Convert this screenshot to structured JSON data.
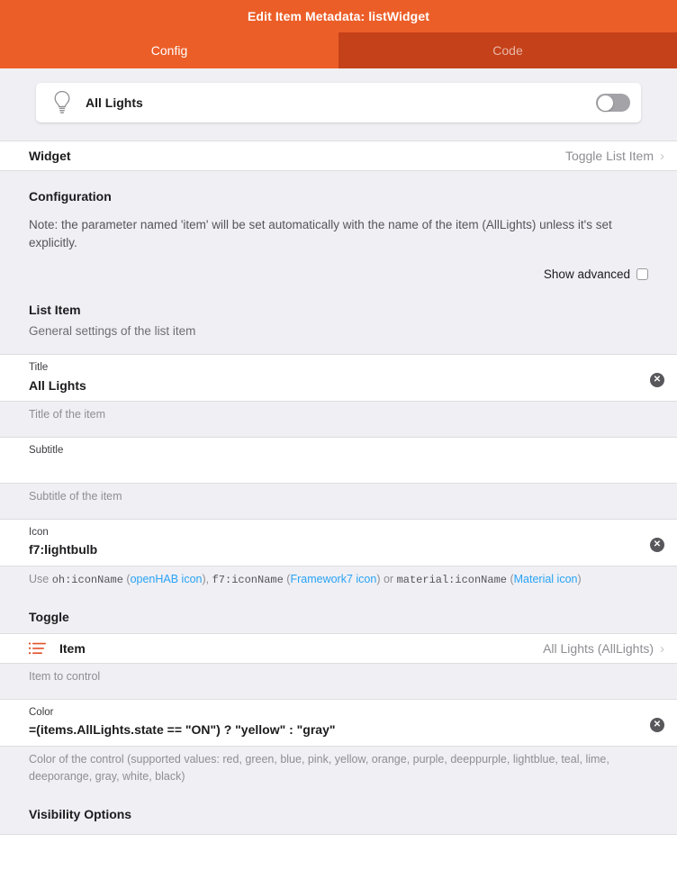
{
  "navbar": {
    "title": "Edit Item Metadata: listWidget"
  },
  "tabs": [
    {
      "label": "Config",
      "active": true
    },
    {
      "label": "Code",
      "active": false
    }
  ],
  "preview": {
    "icon": "lightbulb-icon",
    "label": "All Lights",
    "toggle_state": "off"
  },
  "widget_row": {
    "title": "Widget",
    "value": "Toggle List Item",
    "chevron": "chevron-right-icon"
  },
  "configuration": {
    "title": "Configuration",
    "note": "Note: the parameter named 'item' will be set automatically with the name of the item (AllLights) unless it's set explicitly.",
    "show_advanced_label": "Show advanced",
    "show_advanced_checked": false
  },
  "list_item_section": {
    "title": "List Item",
    "subtitle": "General settings of the list item",
    "fields": [
      {
        "label": "Title",
        "value": "All Lights",
        "helper": "Title of the item",
        "clearable": true
      },
      {
        "label": "Subtitle",
        "value": "",
        "helper": "Subtitle of the item",
        "clearable": false
      },
      {
        "label": "Icon",
        "value": "f7:lightbulb",
        "clearable": true
      }
    ],
    "icon_helper": {
      "prefix": "Use ",
      "code1": "oh:iconName",
      "paren1_open": " (",
      "link1": "openHAB icon",
      "paren1_close": "), ",
      "code2": "f7:iconName",
      "paren2_open": " (",
      "link2": "Framework7 icon",
      "paren2_close": ") or ",
      "code3": "material:iconName",
      "paren3_open": " (",
      "link3": "Material icon",
      "paren3_close": ")"
    }
  },
  "toggle_section": {
    "title": "Toggle",
    "item_row": {
      "lead_icon": "list-bullet-icon",
      "title": "Item",
      "value": "All Lights (AllLights)",
      "chevron": "chevron-right-icon"
    },
    "item_helper": "Item to control",
    "color_field": {
      "label": "Color",
      "value": "=(items.AllLights.state == \"ON\") ? \"yellow\" : \"gray\"",
      "clearable": true
    },
    "color_helper": "Color of the control (supported values: red, green, blue, pink, yellow, orange, purple, deeppurple, lightblue, teal, lime, deeporange, gray, white, black)"
  },
  "visibility_section": {
    "title": "Visibility Options"
  },
  "colors": {
    "brand": "#ec5e28",
    "brand_dark": "#c54119",
    "page_bg": "#efeff4",
    "card": "#ffffff",
    "link": "#29a3f5",
    "muted": "#8e8e93",
    "accent_list_icon": "#e3522a"
  }
}
